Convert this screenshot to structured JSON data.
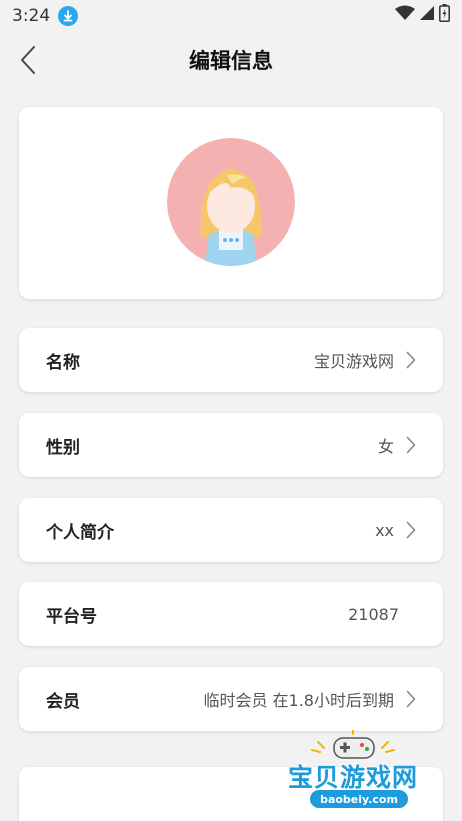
{
  "status": {
    "time": "3:24"
  },
  "nav": {
    "title": "编辑信息"
  },
  "rows": [
    {
      "label": "名称",
      "value": "宝贝游戏网",
      "chevron": true
    },
    {
      "label": "性别",
      "value": "女",
      "chevron": true
    },
    {
      "label": "个人简介",
      "value": "xx",
      "chevron": true
    },
    {
      "label": "平台号",
      "value": "21087",
      "chevron": false
    },
    {
      "label": "会员",
      "value": "临时会员 在1.8小时后到期",
      "chevron": true
    }
  ],
  "watermark": {
    "title": "宝贝游戏网",
    "url": "baobeiy.com"
  },
  "colors": {
    "background": "#f2f2f2",
    "card": "#ffffff",
    "avatar_bg": "#f4b1b1",
    "download_badge": "#29a8f0",
    "watermark": "#1e9bdc"
  },
  "icons": [
    "download-icon",
    "wifi-icon",
    "signal-icon",
    "battery-icon",
    "back-chevron-icon",
    "chevron-right-icon"
  ]
}
